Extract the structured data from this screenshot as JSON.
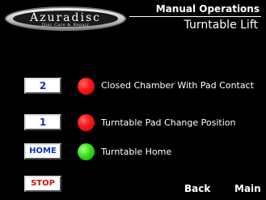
{
  "logo": {
    "name": "Azuradisc",
    "tagline": "Disc Care & Repair"
  },
  "header": {
    "title": "Manual Operations",
    "subtitle": "Turntable Lift"
  },
  "rows": [
    {
      "button": "2",
      "indicator": "red",
      "label": "Closed Chamber With Pad Contact"
    },
    {
      "button": "1",
      "indicator": "red",
      "label": "Turntable Pad Change Position"
    },
    {
      "button": "HOME",
      "indicator": "green",
      "label": "Turntable Home"
    }
  ],
  "stop_button": "STOP",
  "nav": {
    "back": "Back",
    "main": "Main"
  },
  "colors": {
    "button_text_blue": "#1030c8",
    "button_text_red": "#d01010",
    "indicator_red": "#ff1a1a",
    "indicator_green": "#32e01a"
  }
}
